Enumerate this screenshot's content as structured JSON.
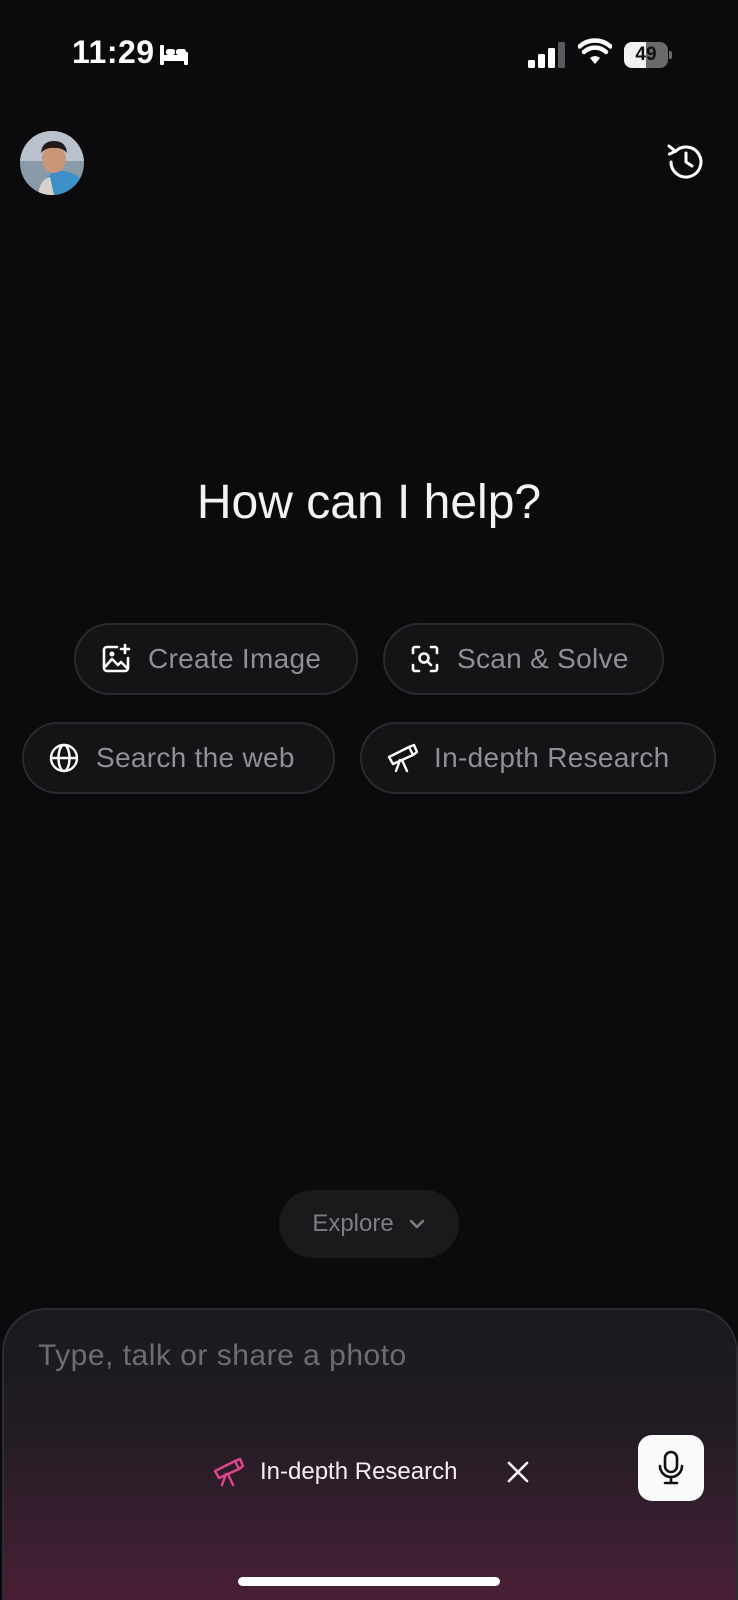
{
  "status_bar": {
    "time": "11:29",
    "battery_level": 49,
    "battery_label": "49"
  },
  "header": {
    "avatar": "user-avatar",
    "history_icon": "history-icon"
  },
  "main": {
    "headline": "How can I help?"
  },
  "chips": [
    {
      "label": "Create Image",
      "icon": "image-plus-icon"
    },
    {
      "label": "Scan & Solve",
      "icon": "scan-search-icon"
    },
    {
      "label": "Search the web",
      "icon": "globe-icon"
    },
    {
      "label": "In-depth Research",
      "icon": "telescope-icon"
    }
  ],
  "explore": {
    "label": "Explore"
  },
  "composer": {
    "placeholder": "Type, talk or share a photo",
    "mode_label": "In-depth Research",
    "mode_icon": "telescope-icon",
    "mode_color": "#e0458f"
  }
}
